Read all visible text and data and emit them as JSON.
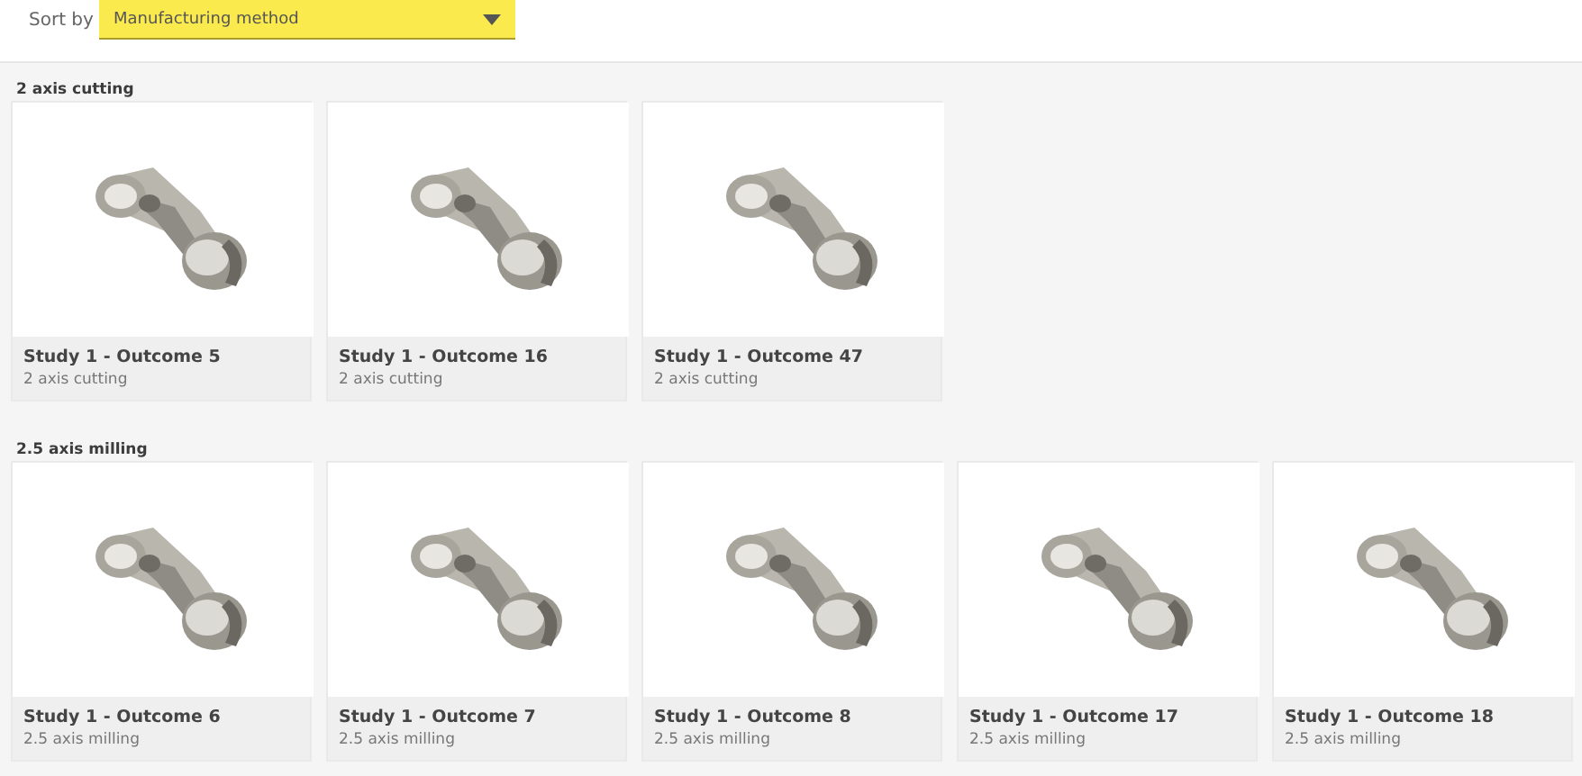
{
  "sort": {
    "label": "Sort by",
    "value": "Manufacturing method"
  },
  "groups": [
    {
      "title": "2 axis cutting",
      "items": [
        {
          "title": "Study 1 - Outcome 5",
          "subtitle": "2 axis cutting",
          "kind": "picture"
        },
        {
          "title": "Study 1 - Outcome 16",
          "subtitle": "2 axis cutting",
          "kind": "picture"
        },
        {
          "title": "Study 1 - Outcome 47",
          "subtitle": "2 axis cutting",
          "kind": "picture"
        }
      ]
    },
    {
      "title": "2.5 axis milling",
      "items": [
        {
          "title": "Study 1 - Outcome 6",
          "subtitle": "2.5 axis milling",
          "kind": "picture"
        },
        {
          "title": "Study 1 - Outcome 7",
          "subtitle": "2.5 axis milling",
          "kind": "picture"
        },
        {
          "title": "Study 1 - Outcome 8",
          "subtitle": "2.5 axis milling",
          "kind": "picture"
        },
        {
          "title": "Study 1 - Outcome 17",
          "subtitle": "2.5 axis milling",
          "kind": "picture"
        },
        {
          "title": "Study 1 - Outcome 18",
          "subtitle": "2.5 axis milling",
          "kind": "picture"
        }
      ]
    }
  ]
}
